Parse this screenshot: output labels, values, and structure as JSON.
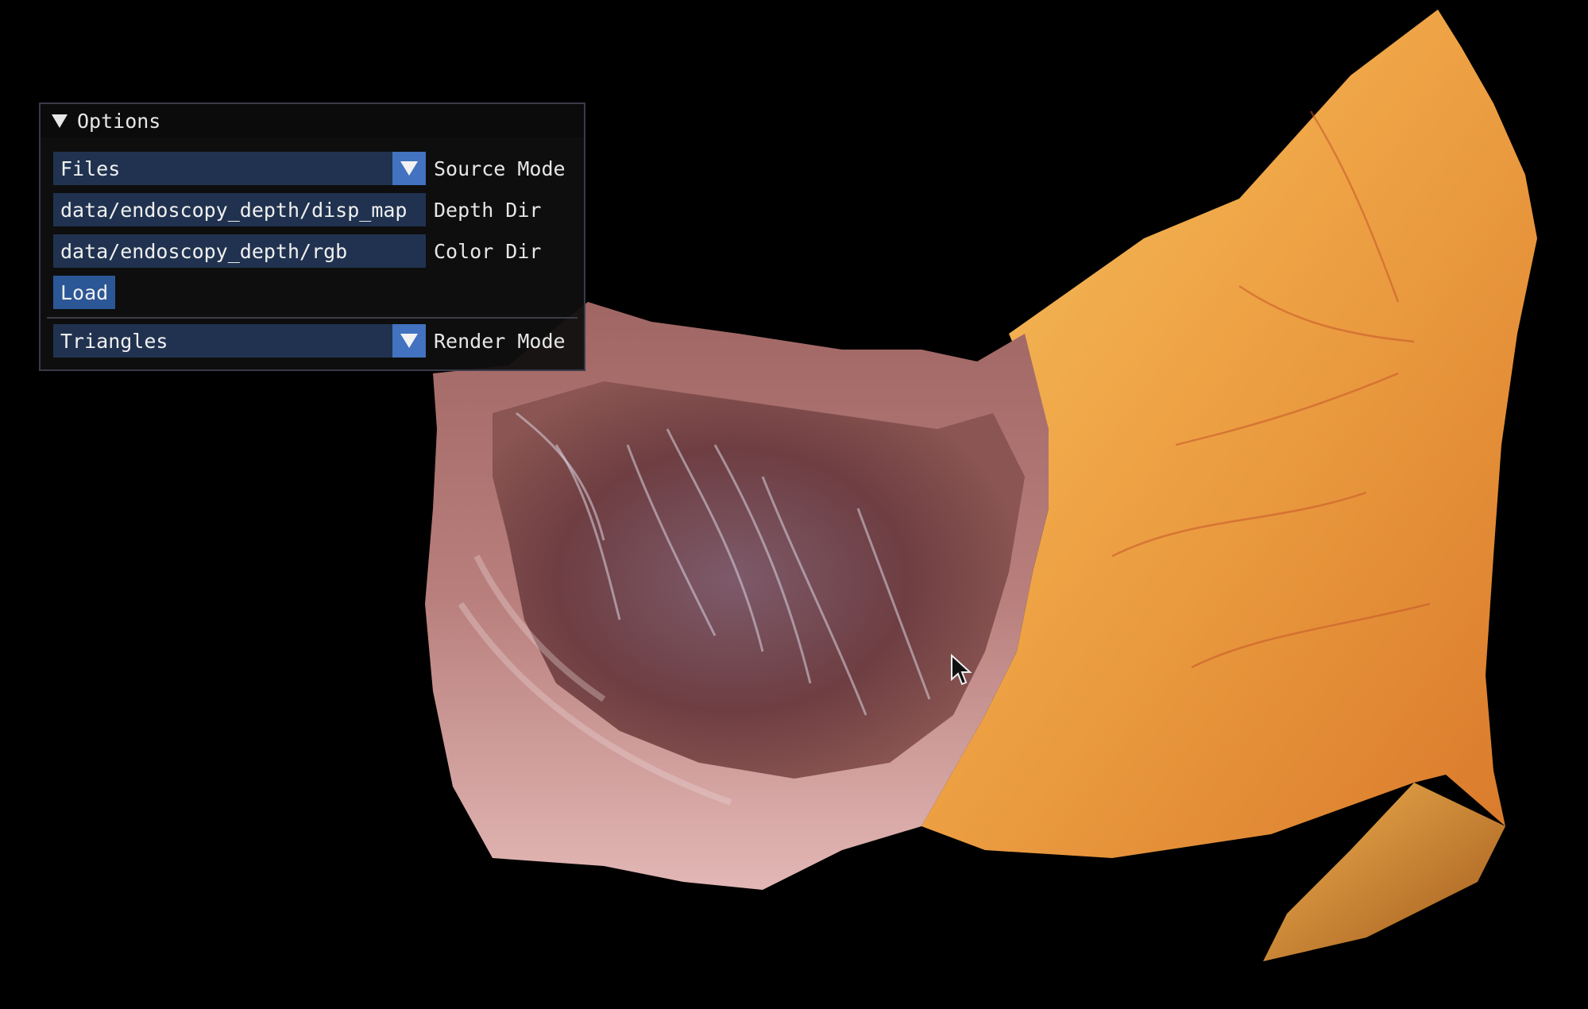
{
  "panel": {
    "title": "Options",
    "source_mode": {
      "value": "Files",
      "label": "Source Mode"
    },
    "depth_dir": {
      "value": "data/endoscopy_depth/disp_map",
      "label": "Depth Dir"
    },
    "color_dir": {
      "value": "data/endoscopy_depth/rgb",
      "label": "Color Dir"
    },
    "load_button": "Load",
    "render_mode": {
      "value": "Triangles",
      "label": "Render Mode"
    }
  },
  "viewport": {
    "content": "endoscopy-3d-surface-mesh",
    "background": "#000000"
  },
  "colors": {
    "panel_bg": "#0f0f0f",
    "widget_bg": "#20324f",
    "combo_arrow": "#4272c0",
    "button": "#2c5796",
    "text": "#e6e6e6"
  }
}
